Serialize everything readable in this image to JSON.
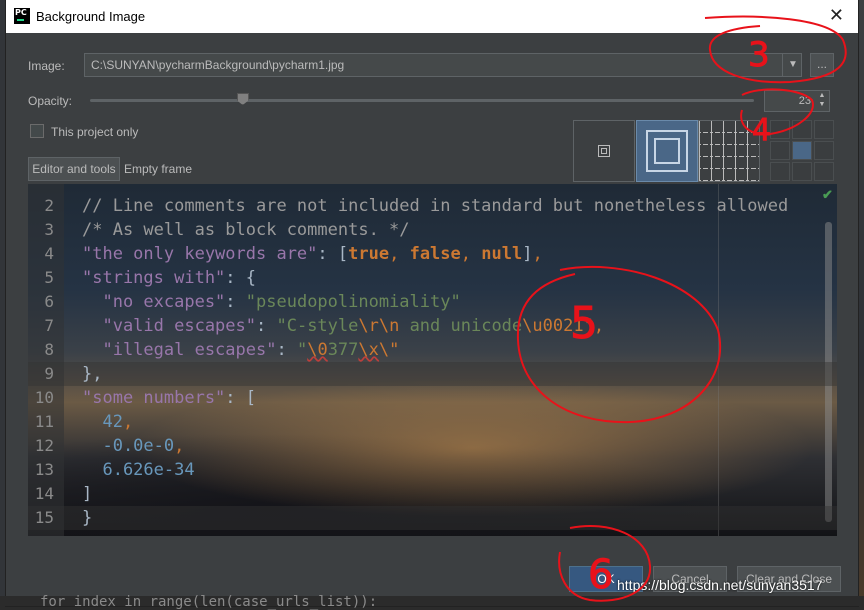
{
  "window": {
    "title": "Background Image"
  },
  "image_row": {
    "label": "Image:",
    "path": "C:\\SUNYAN\\pycharmBackground\\pycharm1.jpg",
    "browse_label": "..."
  },
  "opacity_row": {
    "label": "Opacity:",
    "value": "23",
    "level_percent": 23
  },
  "options": {
    "this_project_only_label": "This project only",
    "this_project_only_checked": false
  },
  "tabs": {
    "editor_label": "Editor and tools",
    "empty_frame_label": "Empty frame"
  },
  "fill_modes": [
    "center-icon",
    "scale-icon",
    "tile-icon"
  ],
  "editor": {
    "lines": [
      {
        "n": "2",
        "segments": [
          {
            "t": "// Line comments are not included in standard but nonetheless allowed",
            "c": "c-comment"
          }
        ]
      },
      {
        "n": "3",
        "segments": [
          {
            "t": "/* As well as block comments. */",
            "c": "c-comment"
          }
        ]
      },
      {
        "n": "4",
        "segments": [
          {
            "t": "\"the only keywords are\"",
            "c": "c-key"
          },
          {
            "t": ": ",
            "c": "c-plain"
          },
          {
            "t": "[",
            "c": "c-plain"
          },
          {
            "t": "true",
            "c": "c-kw"
          },
          {
            "t": ", ",
            "c": "c-punct"
          },
          {
            "t": "false",
            "c": "c-kw"
          },
          {
            "t": ", ",
            "c": "c-punct"
          },
          {
            "t": "null",
            "c": "c-kw"
          },
          {
            "t": "]",
            "c": "c-plain"
          },
          {
            "t": ",",
            "c": "c-punct"
          }
        ]
      },
      {
        "n": "5",
        "segments": [
          {
            "t": "\"strings with\"",
            "c": "c-key"
          },
          {
            "t": ": {",
            "c": "c-plain"
          }
        ]
      },
      {
        "n": "6",
        "segments": [
          {
            "t": "  \"no excapes\"",
            "c": "c-key"
          },
          {
            "t": ": ",
            "c": "c-plain"
          },
          {
            "t": "\"pseudopolinomiality\"",
            "c": "c-str"
          }
        ]
      },
      {
        "n": "7",
        "segments": [
          {
            "t": "  \"valid escapes\"",
            "c": "c-key"
          },
          {
            "t": ": ",
            "c": "c-plain"
          },
          {
            "t": "\"C-style",
            "c": "c-str"
          },
          {
            "t": "\\r\\n",
            "c": "c-esc"
          },
          {
            "t": " and unicode",
            "c": "c-str"
          },
          {
            "t": "\\u0021",
            "c": "c-esc"
          },
          {
            "t": "\"",
            "c": "c-str"
          },
          {
            "t": ",",
            "c": "c-punct"
          }
        ]
      },
      {
        "n": "8",
        "segments": [
          {
            "t": "  \"illegal escapes\"",
            "c": "c-key"
          },
          {
            "t": ": ",
            "c": "c-plain"
          },
          {
            "t": "\"",
            "c": "c-str"
          },
          {
            "t": "\\0",
            "c": "c-bad"
          },
          {
            "t": "377",
            "c": "c-str"
          },
          {
            "t": "\\x",
            "c": "c-bad"
          },
          {
            "t": "\\\"",
            "c": "c-esc"
          }
        ]
      },
      {
        "n": "9",
        "segments": [
          {
            "t": "},",
            "c": "c-plain"
          }
        ]
      },
      {
        "n": "10",
        "segments": [
          {
            "t": "\"some numbers\"",
            "c": "c-key"
          },
          {
            "t": ": [",
            "c": "c-plain"
          }
        ]
      },
      {
        "n": "11",
        "segments": [
          {
            "t": "  42",
            "c": "c-num"
          },
          {
            "t": ",",
            "c": "c-punct"
          }
        ]
      },
      {
        "n": "12",
        "segments": [
          {
            "t": "  -0.0e-0",
            "c": "c-num"
          },
          {
            "t": ",",
            "c": "c-punct"
          }
        ]
      },
      {
        "n": "13",
        "segments": [
          {
            "t": "  6.626e-34",
            "c": "c-num"
          }
        ]
      },
      {
        "n": "14",
        "segments": [
          {
            "t": "]",
            "c": "c-plain"
          }
        ]
      },
      {
        "n": "15",
        "segments": [
          {
            "t": "}",
            "c": "c-plain"
          }
        ]
      }
    ]
  },
  "buttons": {
    "ok_label": "OK",
    "cancel_label": "Cancel",
    "close_label": "Clear and Close"
  },
  "background_code": "for index in range(len(case_urls_list)):",
  "annotations": [
    "3",
    "4",
    "5",
    "6"
  ],
  "watermark": "https://blog.csdn.net/sunyan3517"
}
